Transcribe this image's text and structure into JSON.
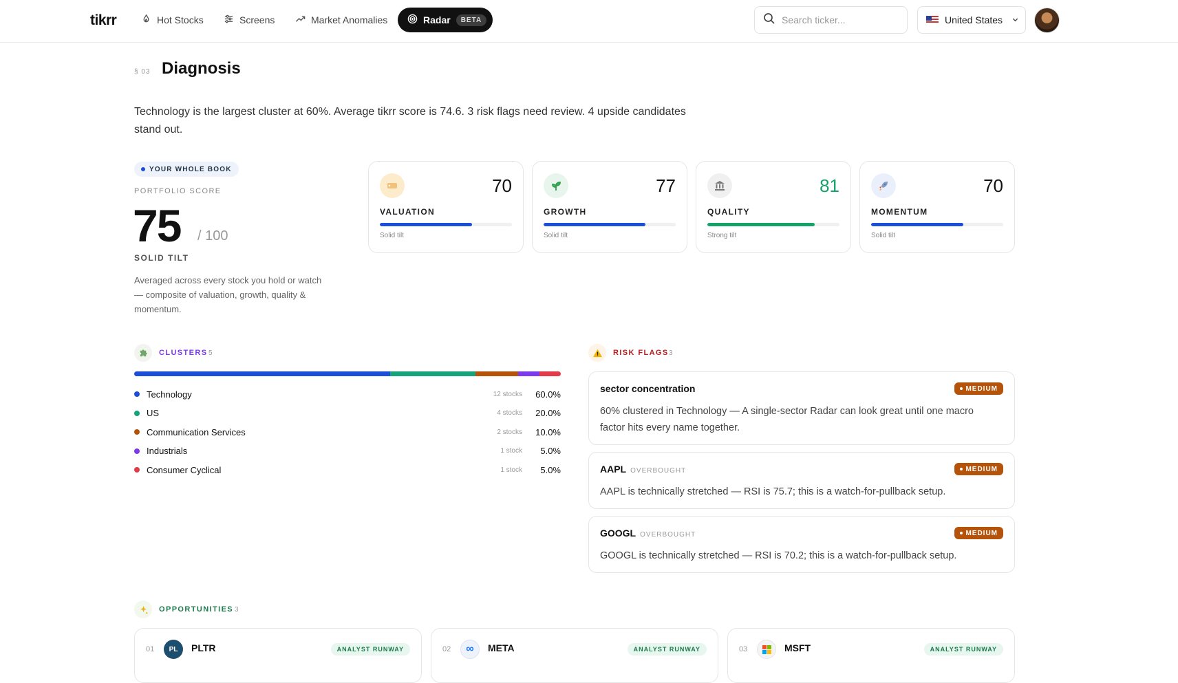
{
  "nav": {
    "logo": "tikrr",
    "items": [
      {
        "label": "Hot Stocks",
        "icon": "flame-icon"
      },
      {
        "label": "Screens",
        "icon": "sliders-icon"
      },
      {
        "label": "Market Anomalies",
        "icon": "trend-up-icon"
      }
    ],
    "radar": {
      "label": "Radar",
      "badge": "BETA",
      "icon": "radar-icon"
    },
    "search_placeholder": "Search ticker...",
    "country": "United States"
  },
  "section": {
    "number": "§ 03",
    "title": "Diagnosis",
    "summary": "Technology is the largest cluster at 60%. Average tikrr score is 74.6. 3 risk flags need review. 4 upside candidates stand out."
  },
  "portfolio": {
    "pill": "YOUR WHOLE BOOK",
    "label": "PORTFOLIO SCORE",
    "score": "75",
    "max": "/ 100",
    "tilt": "SOLID TILT",
    "description": "Averaged across every stock you hold or watch — composite of valuation, growth, quality & momentum."
  },
  "metrics": [
    {
      "label": "VALUATION",
      "score": "70",
      "fill": 0.7,
      "tilt": "Solid tilt",
      "color": "#1d4ed8",
      "score_color": "#111111",
      "icon": "price-tag-icon",
      "icon_bg": "#fdeccb"
    },
    {
      "label": "GROWTH",
      "score": "77",
      "fill": 0.77,
      "tilt": "Solid tilt",
      "color": "#1d4ed8",
      "score_color": "#111111",
      "icon": "sprout-icon",
      "icon_bg": "#e8f5ec"
    },
    {
      "label": "QUALITY",
      "score": "81",
      "fill": 0.81,
      "tilt": "Strong tilt",
      "color": "#16a36a",
      "score_color": "#16a36a",
      "icon": "bank-icon",
      "icon_bg": "#f0f0f0"
    },
    {
      "label": "MOMENTUM",
      "score": "70",
      "fill": 0.7,
      "tilt": "Solid tilt",
      "color": "#1d4ed8",
      "score_color": "#111111",
      "icon": "rocket-icon",
      "icon_bg": "#eaf0fb"
    }
  ],
  "clusters": {
    "title": "CLUSTERS",
    "count": "5",
    "items": [
      {
        "name": "Technology",
        "stocks": "12 stocks",
        "pct": "60.0%",
        "share": 60,
        "color": "#1d4ed8"
      },
      {
        "name": "US",
        "stocks": "4 stocks",
        "pct": "20.0%",
        "share": 20,
        "color": "#16a37a"
      },
      {
        "name": "Communication Services",
        "stocks": "2 stocks",
        "pct": "10.0%",
        "share": 10,
        "color": "#b45309"
      },
      {
        "name": "Industrials",
        "stocks": "1 stock",
        "pct": "5.0%",
        "share": 5,
        "color": "#7c3aed"
      },
      {
        "name": "Consumer Cyclical",
        "stocks": "1 stock",
        "pct": "5.0%",
        "share": 5,
        "color": "#e23b4a"
      }
    ]
  },
  "risk_flags": {
    "title": "RISK FLAGS",
    "count": "3",
    "items": [
      {
        "title": "sector concentration",
        "tag": "",
        "badge": "MEDIUM",
        "body": "60% clustered in Technology — A single-sector Radar can look great until one macro factor hits every name together."
      },
      {
        "title": "AAPL",
        "tag": "OVERBOUGHT",
        "badge": "MEDIUM",
        "body": "AAPL is technically stretched — RSI is 75.7; this is a watch-for-pullback setup."
      },
      {
        "title": "GOOGL",
        "tag": "OVERBOUGHT",
        "badge": "MEDIUM",
        "body": "GOOGL is technically stretched — RSI is 70.2; this is a watch-for-pullback setup."
      }
    ]
  },
  "opportunities": {
    "title": "OPPORTUNITIES",
    "count": "3",
    "items": [
      {
        "num": "01",
        "ticker": "PLTR",
        "logo": "PL",
        "logo_bg": "#1e4e6e",
        "tag": "ANALYST RUNWAY"
      },
      {
        "num": "02",
        "ticker": "META",
        "logo": "∞",
        "logo_bg": "#e8eefb",
        "tag": "ANALYST RUNWAY"
      },
      {
        "num": "03",
        "ticker": "MSFT",
        "logo": "",
        "logo_bg": "#f2f2f2",
        "tag": "ANALYST RUNWAY"
      }
    ]
  }
}
